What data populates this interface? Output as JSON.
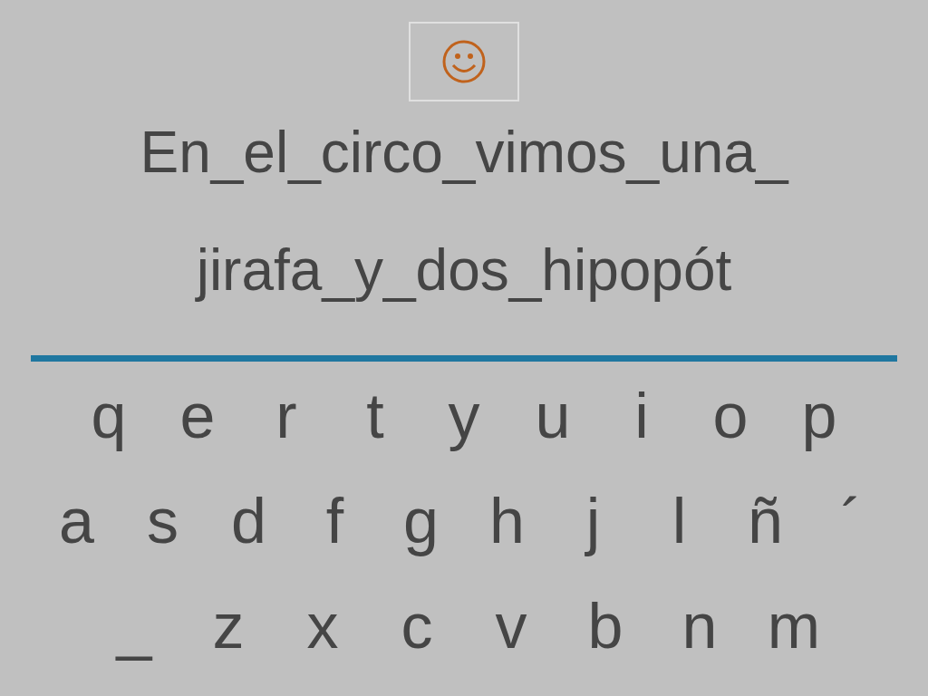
{
  "sentence_lines": [
    "En_el_circo_vimos_una_",
    "jirafa_y_dos_hipopót"
  ],
  "keyboard": {
    "rows": [
      {
        "keys": [
          "q",
          "e",
          "r",
          "t",
          "y",
          "u",
          "i",
          "o",
          "p"
        ]
      },
      {
        "keys": [
          "a",
          "s",
          "d",
          "f",
          "g",
          "h",
          "j",
          "l",
          "ñ",
          "´"
        ]
      },
      {
        "keys": [
          "_",
          "z",
          "x",
          "c",
          "v",
          "b",
          "n",
          "m"
        ]
      }
    ]
  }
}
